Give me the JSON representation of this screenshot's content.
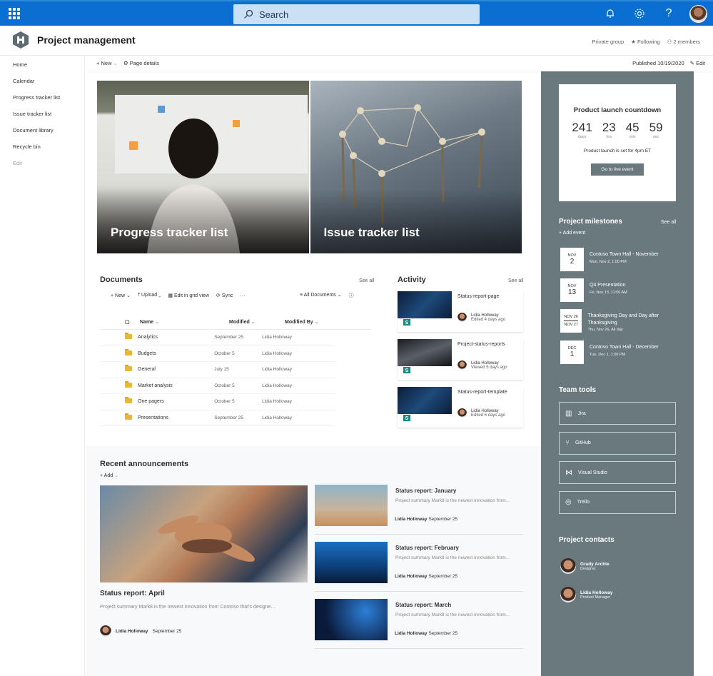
{
  "suitebar": {
    "search_placeholder": "Search",
    "icons": [
      "app-launcher-icon",
      "notification-bell-icon",
      "settings-gear-icon",
      "help-question-icon",
      "user-avatar"
    ]
  },
  "site": {
    "title": "Project management",
    "privacy": "Private group",
    "following": "Following",
    "members": "2 members"
  },
  "nav": {
    "items": [
      "Home",
      "Calendar",
      "Progress tracker list",
      "Issue tracker list",
      "Document library",
      "Recycle bin"
    ],
    "edit": "Edit"
  },
  "commandbar": {
    "new": "New",
    "page_details": "Page details",
    "published": "Published 10/19/2020",
    "edit": "Edit"
  },
  "hero": {
    "tiles": [
      "Progress tracker list",
      "Issue tracker list"
    ]
  },
  "documents": {
    "title": "Documents",
    "see_all": "See all",
    "toolbar": {
      "new": "New",
      "upload": "Upload",
      "grid": "Edit in grid view",
      "sync": "Sync",
      "more": "···",
      "view": "All Documents"
    },
    "columns": [
      "Name",
      "Modified",
      "Modified By"
    ],
    "rows": [
      {
        "name": "Analytics",
        "modified": "September 25",
        "by": "Lidia Holloway"
      },
      {
        "name": "Budgets",
        "modified": "October 5",
        "by": "Lidia Holloway"
      },
      {
        "name": "General",
        "modified": "July 15",
        "by": "Lidia Holloway"
      },
      {
        "name": "Market analysis",
        "modified": "October 5",
        "by": "Lidia Holloway"
      },
      {
        "name": "One pagers",
        "modified": "October 5",
        "by": "Lidia Holloway"
      },
      {
        "name": "Presentations",
        "modified": "September 25",
        "by": "Lidia Holloway"
      }
    ]
  },
  "activity": {
    "title": "Activity",
    "see_all": "See all",
    "items": [
      {
        "title": "Status-report-page",
        "person": "Lidia Holloway",
        "status": "Edited 4 days ago"
      },
      {
        "title": "Project-status-reports",
        "person": "Lidia Holloway",
        "status": "Viewed 5 days ago"
      },
      {
        "title": "Status-report-template",
        "person": "Lidia Holloway",
        "status": "Edited 6 days ago"
      }
    ]
  },
  "announcements": {
    "title": "Recent announcements",
    "add": "Add",
    "featured": {
      "title": "Status report: April",
      "desc": "Project summary Mark8 is the newest innovation from Contoso that's designe...",
      "author": "Lidia Holloway",
      "date": "September 25"
    },
    "items": [
      {
        "title": "Status report: January",
        "desc": "Project summary Mark8 is the newest innovation from...",
        "author": "Lidia Holloway",
        "date": "September 25"
      },
      {
        "title": "Status report: February",
        "desc": "Project summary Mark8 is the newest innovation from...",
        "author": "Lidia Holloway",
        "date": "September 25"
      },
      {
        "title": "Status report: March",
        "desc": "Project summary Mark8 is the newest innovation from...",
        "author": "Lidia Holloway",
        "date": "September 25"
      }
    ]
  },
  "countdown": {
    "title": "Product launch countdown",
    "values": [
      {
        "n": "241",
        "u": "days"
      },
      {
        "n": "23",
        "u": "hrs"
      },
      {
        "n": "45",
        "u": "min"
      },
      {
        "n": "59",
        "u": "sec"
      }
    ],
    "note": "Product launch is set for 4pm ET",
    "button": "Go to live event"
  },
  "milestones": {
    "title": "Project milestones",
    "see_all": "See all",
    "add": "Add event",
    "items": [
      {
        "month": "NOV",
        "day": "2",
        "title": "Contoso Town Hall - November",
        "when": "Mon, Nov 2, 1:00 PM"
      },
      {
        "month": "NOV",
        "day": "13",
        "title": "Q4 Presentation",
        "when": "Fri, Nov 13, 11:00 AM"
      },
      {
        "start": "NOV 26",
        "end": "NOV 27",
        "title": "Thanksgiving Day and Day after Thanksgiving",
        "when": "Thu, Nov 26, All day"
      },
      {
        "month": "DEC",
        "day": "1",
        "title": "Contoso Town Hall - December",
        "when": "Tue, Dec 1, 1:00 PM"
      }
    ]
  },
  "team_tools": {
    "title": "Team tools",
    "items": [
      "Jira",
      "GitHub",
      "Visual Studio",
      "Trello"
    ]
  },
  "contacts": {
    "title": "Project contacts",
    "items": [
      {
        "name": "Grady Archie",
        "role": "Designer"
      },
      {
        "name": "Lidia Holloway",
        "role": "Product Manager"
      }
    ]
  },
  "colors": {
    "suitebar": "#0a6fd0",
    "rail": "#69797e",
    "accent": "#0078d4"
  }
}
